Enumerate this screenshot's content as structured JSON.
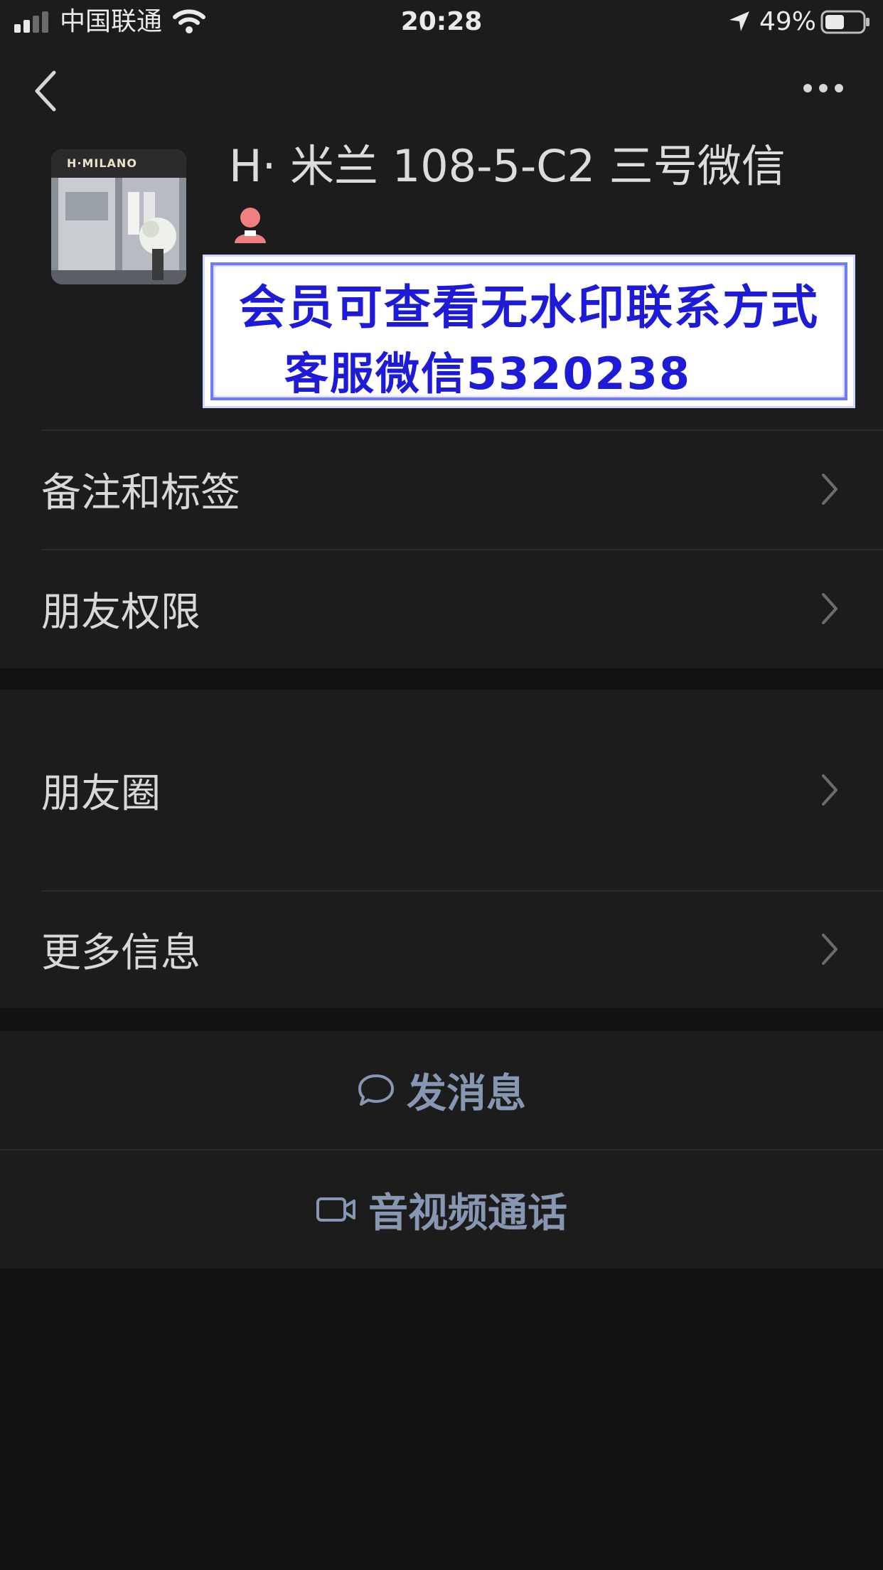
{
  "status_bar": {
    "carrier": "中国联通",
    "time": "20:28",
    "battery_percent": "49%"
  },
  "nav": {
    "back_icon": "chevron-left-icon",
    "more_icon": "more-dots-icon"
  },
  "profile": {
    "name": "H· 米兰  108-5-C2 三号微信",
    "avatar_sign": "H·MILANO",
    "avatar_icon": "store-photo",
    "person_icon": "female-person-icon"
  },
  "watermark": {
    "line1": "会员可查看无水印联系方式",
    "line2": "客服微信5320238"
  },
  "menu_group_1": {
    "items": [
      {
        "label": "备注和标签"
      },
      {
        "label": "朋友权限"
      }
    ]
  },
  "menu_group_2": {
    "items": [
      {
        "label": "朋友圈"
      },
      {
        "label": "更多信息"
      }
    ]
  },
  "actions": {
    "send_message": "发消息",
    "video_call": "音视频通话"
  },
  "colors": {
    "background": "#111111",
    "cell": "#1c1c1c",
    "action_text": "#8797b2",
    "watermark_text": "#1e1bd8"
  }
}
